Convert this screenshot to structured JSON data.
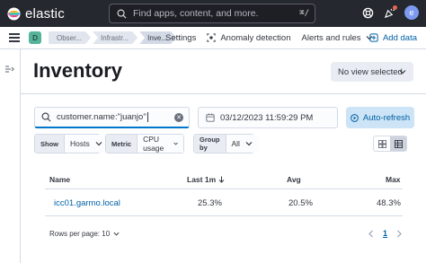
{
  "header": {
    "brand": "elastic",
    "search_placeholder": "Find apps, content, and more.",
    "search_shortcut": "⌘/",
    "user_initial": "e"
  },
  "nav": {
    "space_initial": "D",
    "breadcrumbs": [
      "Obser...",
      "Infrastr...",
      "Inve..."
    ],
    "links": {
      "settings": "Settings",
      "anomaly": "Anomaly detection",
      "alerts": "Alerts and rules",
      "add_data": "Add data"
    }
  },
  "page": {
    "title": "Inventory",
    "view_select": "No view selected"
  },
  "query": {
    "value": "customer.name:\"juanjo\"",
    "date": "03/12/2023 11:59:29 PM",
    "refresh_label": "Auto-refresh"
  },
  "filters": {
    "show_label": "Show",
    "show_value": "Hosts",
    "metric_label": "Metric",
    "metric_value": "CPU usage",
    "groupby_label": "Group by",
    "groupby_value": "All"
  },
  "table": {
    "columns": [
      "Name",
      "Last 1m",
      "Avg",
      "Max"
    ],
    "sorted_column": "Last 1m",
    "rows": [
      {
        "name": "icc01.garmo.local",
        "last": "25.3%",
        "avg": "20.5%",
        "max": "48.3%"
      }
    ],
    "rows_per_page": "Rows per page: 10",
    "current_page": "1"
  },
  "colors": {
    "header_bg": "#25282f",
    "link": "#0061a6",
    "accent": "#0077cc",
    "logo": [
      "#f0b31f",
      "#00b2a8",
      "#e7478b",
      "#3fbeb0"
    ]
  }
}
